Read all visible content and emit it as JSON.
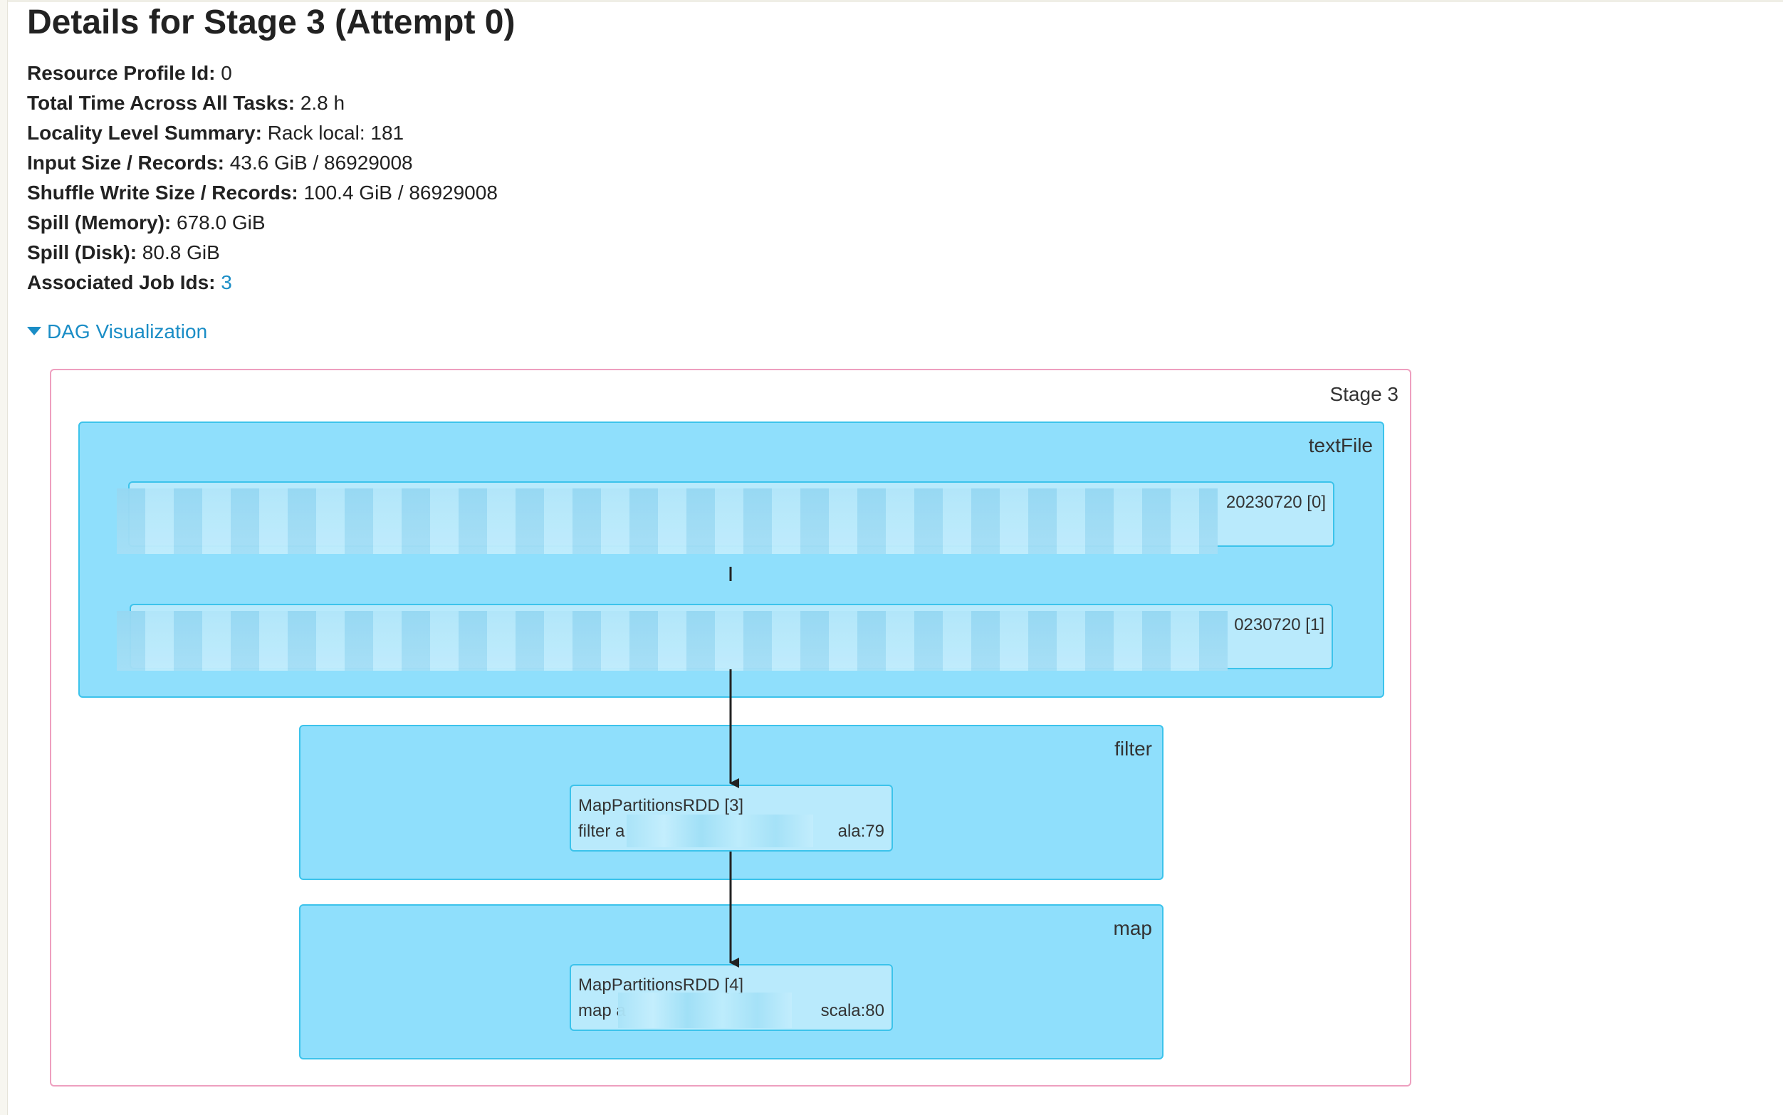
{
  "title": "Details for Stage 3 (Attempt 0)",
  "summary": {
    "resource_profile_label": "Resource Profile Id:",
    "resource_profile_value": "0",
    "total_time_label": "Total Time Across All Tasks:",
    "total_time_value": "2.8 h",
    "locality_label": "Locality Level Summary:",
    "locality_value": "Rack local: 181",
    "input_label": "Input Size / Records:",
    "input_value": "43.6 GiB / 86929008",
    "shuffle_label": "Shuffle Write Size / Records:",
    "shuffle_value": "100.4 GiB / 86929008",
    "spill_memory_label": "Spill (Memory):",
    "spill_memory_value": "678.0 GiB",
    "spill_disk_label": "Spill (Disk):",
    "spill_disk_value": "80.8 GiB",
    "job_ids_label": "Associated Job Ids:",
    "job_ids_value": "3"
  },
  "dag": {
    "toggle_label": "DAG Visualization",
    "stage_label": "Stage 3",
    "clusters": {
      "textfile": {
        "label": "textFile",
        "node0_suffix": "20230720 [0]",
        "node1_suffix": "0230720 [1]"
      },
      "filter": {
        "label": "filter",
        "node_title": "MapPartitionsRDD [3]",
        "node_detail_left": "filter a",
        "node_detail_right": "ala:79"
      },
      "map": {
        "label": "map",
        "node_title": "MapPartitionsRDD [4]",
        "node_detail_left": "map a",
        "node_detail_right": "scala:80"
      }
    }
  },
  "colors": {
    "link": "#1a8dc6",
    "cluster_fill": "#8fdffc",
    "cluster_border": "#3cc3eb",
    "node_fill": "#b9eafc",
    "stage_border": "#ee9fbf"
  }
}
